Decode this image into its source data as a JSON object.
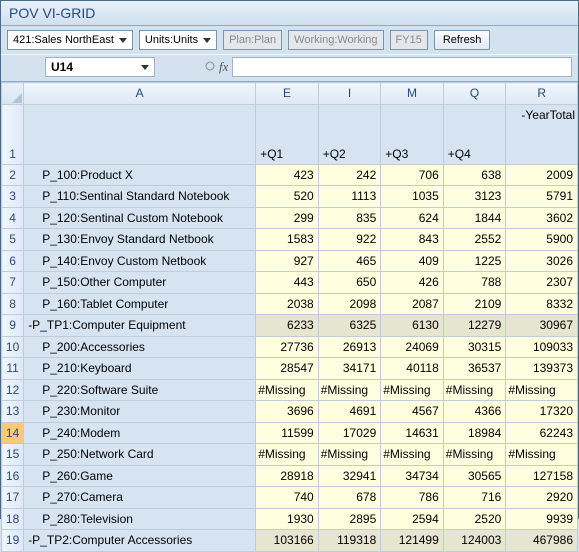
{
  "title": "POV VI-GRID",
  "pov": {
    "dim1": "421:Sales NorthEast",
    "dim2": "Units:Units",
    "plan": "Plan:Plan",
    "working": "Working:Working",
    "year": "FY15",
    "refresh": "Refresh"
  },
  "namebox": "U14",
  "fx_label": "fx",
  "columns": {
    "A": "A",
    "E": "E",
    "I": "I",
    "M": "M",
    "Q": "Q",
    "R": "R"
  },
  "headers": {
    "q1": "+Q1",
    "q2": "+Q2",
    "q3": "+Q3",
    "q4": "+Q4",
    "yt": "-YearTotal",
    "row1": "1"
  },
  "rows": [
    {
      "n": "2",
      "label": "P_100:Product X",
      "indent": true,
      "v": [
        "423",
        "242",
        "706",
        "638",
        "2009"
      ]
    },
    {
      "n": "3",
      "label": "P_110:Sentinal Standard Notebook",
      "indent": true,
      "v": [
        "520",
        "1113",
        "1035",
        "3123",
        "5791"
      ]
    },
    {
      "n": "4",
      "label": "P_120:Sentinal Custom Notebook",
      "indent": true,
      "v": [
        "299",
        "835",
        "624",
        "1844",
        "3602"
      ]
    },
    {
      "n": "5",
      "label": "P_130:Envoy Standard Netbook",
      "indent": true,
      "v": [
        "1583",
        "922",
        "843",
        "2552",
        "5900"
      ]
    },
    {
      "n": "6",
      "label": "P_140:Envoy Custom Netbook",
      "indent": true,
      "v": [
        "927",
        "465",
        "409",
        "1225",
        "3026"
      ]
    },
    {
      "n": "7",
      "label": "P_150:Other Computer",
      "indent": true,
      "v": [
        "443",
        "650",
        "426",
        "788",
        "2307"
      ]
    },
    {
      "n": "8",
      "label": "P_160:Tablet Computer",
      "indent": true,
      "v": [
        "2038",
        "2098",
        "2087",
        "2109",
        "8332"
      ]
    },
    {
      "n": "9",
      "label": "-P_TP1:Computer Equipment",
      "indent": false,
      "sub": true,
      "v": [
        "6233",
        "6325",
        "6130",
        "12279",
        "30967"
      ]
    },
    {
      "n": "10",
      "label": "P_200:Accessories",
      "indent": true,
      "v": [
        "27736",
        "26913",
        "24069",
        "30315",
        "109033"
      ]
    },
    {
      "n": "11",
      "label": "P_210:Keyboard",
      "indent": true,
      "v": [
        "28547",
        "34171",
        "40118",
        "36537",
        "139373"
      ]
    },
    {
      "n": "12",
      "label": "P_220:Software Suite",
      "indent": true,
      "miss": true,
      "v": [
        "#Missing",
        "#Missing",
        "#Missing",
        "#Missing",
        "#Missing"
      ]
    },
    {
      "n": "13",
      "label": "P_230:Monitor",
      "indent": true,
      "v": [
        "3696",
        "4691",
        "4567",
        "4366",
        "17320"
      ]
    },
    {
      "n": "14",
      "label": "P_240:Modem",
      "indent": true,
      "active": true,
      "v": [
        "11599",
        "17029",
        "14631",
        "18984",
        "62243"
      ]
    },
    {
      "n": "15",
      "label": "P_250:Network Card",
      "indent": true,
      "miss": true,
      "v": [
        "#Missing",
        "#Missing",
        "#Missing",
        "#Missing",
        "#Missing"
      ]
    },
    {
      "n": "16",
      "label": "P_260:Game",
      "indent": true,
      "v": [
        "28918",
        "32941",
        "34734",
        "30565",
        "127158"
      ]
    },
    {
      "n": "17",
      "label": "P_270:Camera",
      "indent": true,
      "v": [
        "740",
        "678",
        "786",
        "716",
        "2920"
      ]
    },
    {
      "n": "18",
      "label": "P_280:Television",
      "indent": true,
      "v": [
        "1930",
        "2895",
        "2594",
        "2520",
        "9939"
      ]
    },
    {
      "n": "19",
      "label": "-P_TP2:Computer Accessories",
      "indent": false,
      "sub": true,
      "v": [
        "103166",
        "119318",
        "121499",
        "124003",
        "467986"
      ]
    }
  ]
}
